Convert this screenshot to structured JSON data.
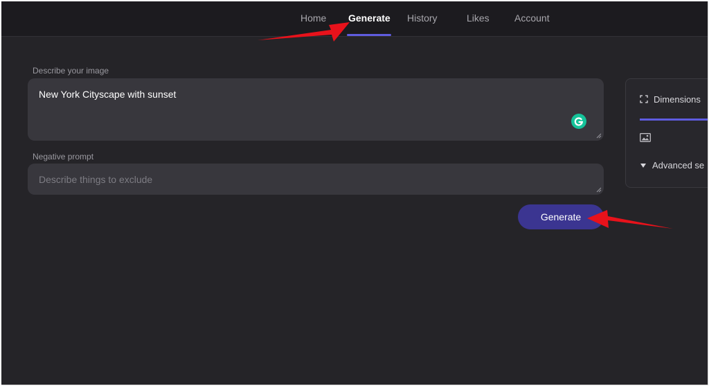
{
  "nav": {
    "items": [
      {
        "label": "Home"
      },
      {
        "label": "Generate"
      },
      {
        "label": "History"
      },
      {
        "label": "Likes"
      },
      {
        "label": "Account"
      }
    ],
    "active": "Generate"
  },
  "prompt": {
    "label": "Describe your image",
    "value": "New York Cityscape with sunset"
  },
  "negative_prompt": {
    "label": "Negative prompt",
    "placeholder": "Describe things to exclude"
  },
  "generate_button": {
    "label": "Generate"
  },
  "side_panel": {
    "dimensions_label": "Dimensions",
    "advanced_label": "Advanced se"
  },
  "colors": {
    "accent": "#5f5ce0",
    "button": "#3b3591",
    "annotation_arrow": "#e8121b",
    "grammarly": "#15c39a"
  },
  "icons": {
    "dimensions": "expand-corners-icon",
    "image": "image-icon",
    "advanced": "caret-down-icon",
    "assistant": "grammarly-icon"
  }
}
